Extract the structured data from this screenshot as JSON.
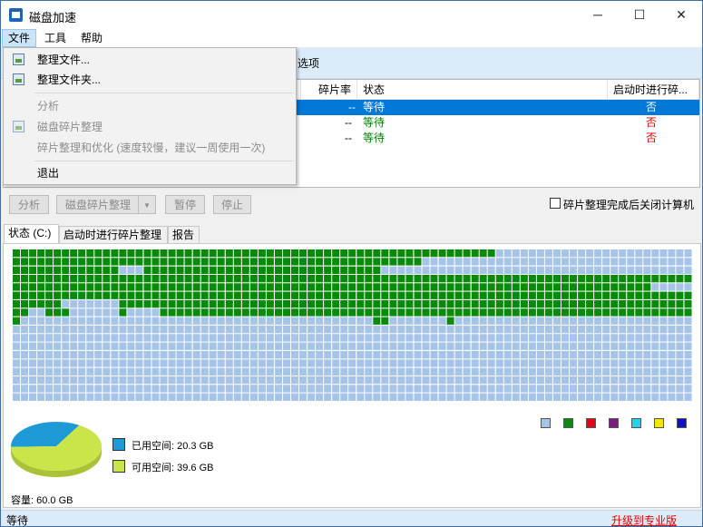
{
  "window": {
    "title": "磁盘加速",
    "minimize": "─",
    "maximize": "☐",
    "close": "✕"
  },
  "menu": {
    "items": [
      "文件",
      "工具",
      "帮助"
    ]
  },
  "toolbar": {
    "options_label": "选项"
  },
  "list": {
    "columns": [
      "碎片率",
      "状态",
      "启动时进行碎..."
    ],
    "rows": [
      {
        "frag": "--",
        "status": "等待",
        "boot": "否",
        "selected": true
      },
      {
        "frag": "--",
        "status": "等待",
        "boot": "否",
        "selected": false
      },
      {
        "frag": "--",
        "status": "等待",
        "boot": "否",
        "selected": false
      }
    ]
  },
  "controls": {
    "analyze": "分析",
    "defrag": "磁盘碎片整理",
    "pause": "暂停",
    "stop": "停止",
    "shutdown_label": "碎片整理完成后关闭计算机"
  },
  "tabs": [
    "状态 (C:)",
    "启动时进行碎片整理",
    "报告"
  ],
  "legend_colors": [
    "#a6c4e8",
    "#0a8a0a",
    "#e8001a",
    "#7a1f80",
    "#22d2e8",
    "#f5e600",
    "#1010c8"
  ],
  "disk": {
    "used_label": "已用空间: 20.3 GB",
    "free_label": "可用空间: 39.6 GB",
    "capacity_label": "容量: 60.0 GB",
    "used_gb": 20.3,
    "free_gb": 39.6,
    "used_color": "#1e9ad6",
    "free_color": "#c8e64a"
  },
  "status": {
    "left": "等待",
    "upgrade": "升级到专业版"
  },
  "file_menu": {
    "items": [
      {
        "label": "整理文件...",
        "icon": "file-icon",
        "enabled": true
      },
      {
        "label": "整理文件夹...",
        "icon": "folder-icon",
        "enabled": true
      },
      {
        "label": "分析",
        "icon": "",
        "enabled": false
      },
      {
        "label": "磁盘碎片整理",
        "icon": "disk-icon",
        "enabled": false
      },
      {
        "label": "碎片整理和优化 (速度较慢，建议一周使用一次)",
        "icon": "",
        "enabled": false
      },
      {
        "label": "退出",
        "icon": "",
        "enabled": true
      }
    ]
  }
}
